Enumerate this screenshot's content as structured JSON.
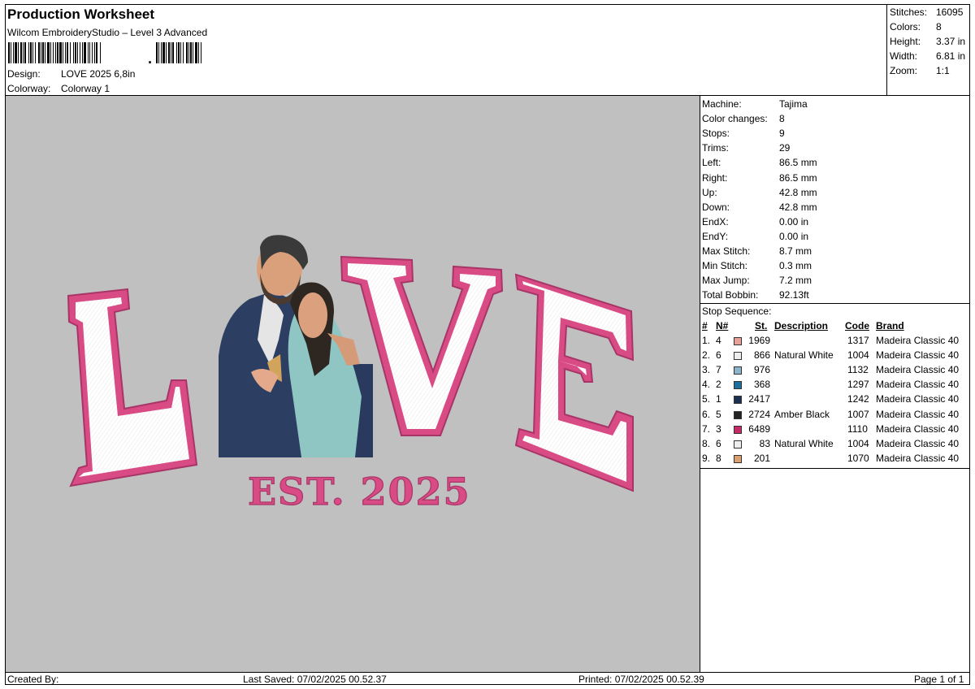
{
  "header": {
    "title": "Production Worksheet",
    "subtitle": "Wilcom EmbroideryStudio – Level 3 Advanced",
    "barcode_suffix": ",",
    "design_label": "Design:",
    "design_value": "LOVE 2025 6,8in",
    "colorway_label": "Colorway:",
    "colorway_value": "Colorway 1"
  },
  "stats": [
    {
      "label": "Stitches:",
      "value": "16095"
    },
    {
      "label": "Colors:",
      "value": "8"
    },
    {
      "label": "Height:",
      "value": "3.37 in"
    },
    {
      "label": "Width:",
      "value": "6.81 in"
    },
    {
      "label": "Zoom:",
      "value": "1:1"
    }
  ],
  "design": {
    "letters": [
      "L",
      "V",
      "E"
    ],
    "est_text": "EST.  2025",
    "thread_pink": "#d94b85",
    "outline_pink": "#a83567"
  },
  "machine_info": [
    {
      "label": "Machine:",
      "value": "Tajima"
    },
    {
      "label": "Color changes:",
      "value": "8"
    },
    {
      "label": "Stops:",
      "value": "9"
    },
    {
      "label": "Trims:",
      "value": "29"
    },
    {
      "label": "Left:",
      "value": "86.5 mm"
    },
    {
      "label": "Right:",
      "value": "86.5 mm"
    },
    {
      "label": "Up:",
      "value": "42.8 mm"
    },
    {
      "label": "Down:",
      "value": "42.8 mm"
    },
    {
      "label": "EndX:",
      "value": "0.00 in"
    },
    {
      "label": "EndY:",
      "value": "0.00 in"
    },
    {
      "label": "Max Stitch:",
      "value": "8.7 mm"
    },
    {
      "label": "Min Stitch:",
      "value": "0.3 mm"
    },
    {
      "label": "Max Jump:",
      "value": "7.2 mm"
    },
    {
      "label": "Total Bobbin:",
      "value": "92.13ft"
    }
  ],
  "stop_sequence": {
    "title": "Stop Sequence:",
    "headers": {
      "num": "#",
      "n": "N#",
      "st": "St.",
      "description": "Description",
      "code": "Code",
      "brand": "Brand"
    },
    "rows": [
      {
        "num": "1.",
        "n": "4",
        "color": "#e8a09a",
        "st": "1969",
        "description": "",
        "code": "1317",
        "brand": "Madeira Classic 40"
      },
      {
        "num": "2.",
        "n": "6",
        "color": "#eeeeee",
        "st": "866",
        "description": "Natural White",
        "code": "1004",
        "brand": "Madeira Classic 40"
      },
      {
        "num": "3.",
        "n": "7",
        "color": "#8fb3cc",
        "st": "976",
        "description": "",
        "code": "1132",
        "brand": "Madeira Classic 40"
      },
      {
        "num": "4.",
        "n": "2",
        "color": "#1f6f9a",
        "st": "368",
        "description": "",
        "code": "1297",
        "brand": "Madeira Classic 40"
      },
      {
        "num": "5.",
        "n": "1",
        "color": "#1d2f4f",
        "st": "2417",
        "description": "",
        "code": "1242",
        "brand": "Madeira Classic 40"
      },
      {
        "num": "6.",
        "n": "5",
        "color": "#232323",
        "st": "2724",
        "description": "Amber Black",
        "code": "1007",
        "brand": "Madeira Classic 40"
      },
      {
        "num": "7.",
        "n": "3",
        "color": "#c52a66",
        "st": "6489",
        "description": "",
        "code": "1110",
        "brand": "Madeira Classic 40"
      },
      {
        "num": "8.",
        "n": "6",
        "color": "#eeeeee",
        "st": "83",
        "description": "Natural White",
        "code": "1004",
        "brand": "Madeira Classic 40"
      },
      {
        "num": "9.",
        "n": "8",
        "color": "#d9a071",
        "st": "201",
        "description": "",
        "code": "1070",
        "brand": "Madeira Classic 40"
      }
    ]
  },
  "footer": {
    "created_by": "Created By:",
    "last_saved": "Last Saved: 07/02/2025 00.52.37",
    "printed": "Printed: 07/02/2025 00.52.39",
    "page": "Page 1 of 1"
  }
}
